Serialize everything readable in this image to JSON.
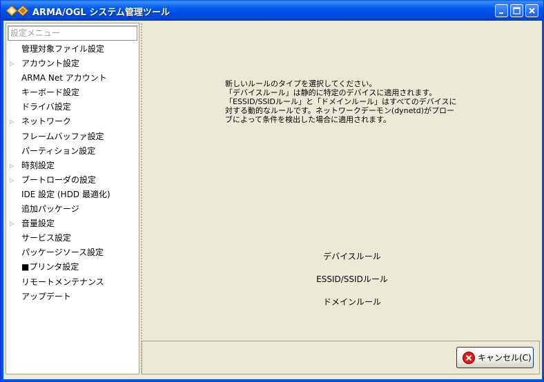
{
  "window": {
    "title": "ARMA/OGL システム管理ツール",
    "icon": "arma-diamond-icon",
    "controls": {
      "minimize": "minimize-icon",
      "maximize": "maximize-icon",
      "close": "close-icon"
    }
  },
  "sidebar": {
    "search_placeholder": "設定メニュー",
    "items": [
      {
        "label": "管理対象ファイル設定",
        "expandable": false
      },
      {
        "label": "アカウント設定",
        "expandable": true
      },
      {
        "label": "ARMA Net アカウント",
        "expandable": false
      },
      {
        "label": "キーボード設定",
        "expandable": false
      },
      {
        "label": "ドライバ設定",
        "expandable": false
      },
      {
        "label": "ネットワーク",
        "expandable": true
      },
      {
        "label": "フレームバッファ設定",
        "expandable": false
      },
      {
        "label": "パーティション設定",
        "expandable": false
      },
      {
        "label": "時刻設定",
        "expandable": true
      },
      {
        "label": "ブートローダの設定",
        "expandable": true
      },
      {
        "label": "IDE 設定 (HDD 最適化)",
        "expandable": false
      },
      {
        "label": "追加パッケージ",
        "expandable": false
      },
      {
        "label": "音量設定",
        "expandable": true
      },
      {
        "label": "サービス設定",
        "expandable": false
      },
      {
        "label": "パッケージソース設定",
        "expandable": false
      },
      {
        "label": "■プリンタ設定",
        "expandable": false
      },
      {
        "label": "リモートメンテナンス",
        "expandable": false
      },
      {
        "label": "アップデート",
        "expandable": false
      }
    ]
  },
  "main": {
    "description": "新しいルールのタイプを選択してください。\n「デバイスルール」は静的に特定のデバイスに適用されます。\n「ESSID/SSIDルール」と「ドメインルール」はすべてのデバイスに\n対する動的なルールです。ネットワークデーモン(dynetd)がプロー\nブによって条件を検出した場合に適用されます。",
    "rule_buttons": [
      {
        "label": "デバイスルール"
      },
      {
        "label": "ESSID/SSIDルール"
      },
      {
        "label": "ドメインルール"
      }
    ]
  },
  "footer": {
    "cancel_label": "キャンセル(C)",
    "cancel_icon": "cancel-icon"
  }
}
